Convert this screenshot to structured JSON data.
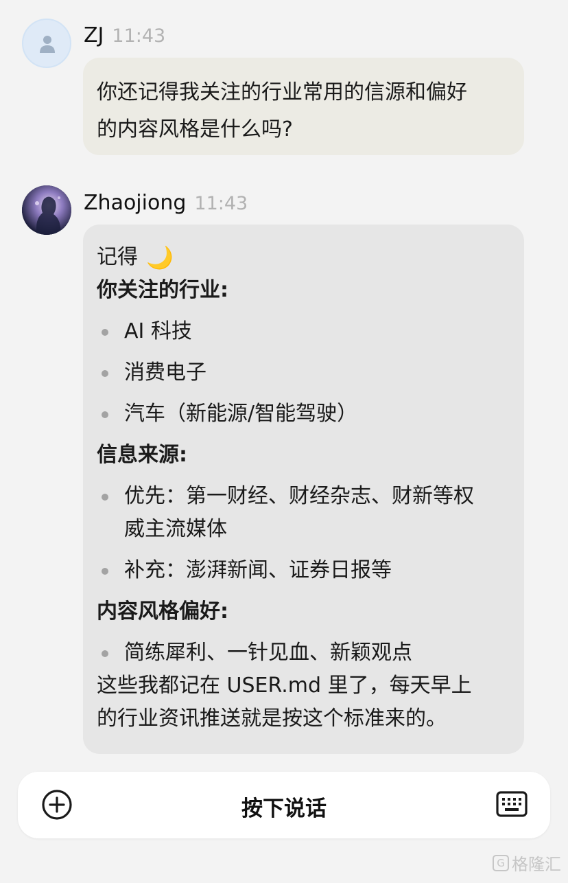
{
  "user_message": {
    "sender": "ZJ",
    "time": "11:43",
    "lines": [
      "你还记得我关注的行业常用的信源和偏好",
      "的内容风格是什么吗?"
    ]
  },
  "bot_message": {
    "sender": "Zhaojiong",
    "time": "11:43",
    "intro": "记得",
    "intro_emoji": "🌙",
    "sections": [
      {
        "heading": "你关注的行业:",
        "items": [
          [
            "AI 科技"
          ],
          [
            "消费电子"
          ],
          [
            "汽车（新能源/智能驾驶）"
          ]
        ]
      },
      {
        "heading": "信息来源:",
        "items": [
          [
            "优先：第一财经、财经杂志、财新等权",
            "威主流媒体"
          ],
          [
            "补充：澎湃新闻、证券日报等"
          ]
        ]
      },
      {
        "heading": "内容风格偏好:",
        "items": [
          [
            "简练犀利、一针见血、新颖观点"
          ]
        ]
      }
    ],
    "closing": [
      "这些我都记在 USER.md 里了，每天早上",
      "的行业资讯推送就是按这个标准来的。"
    ]
  },
  "input_bar": {
    "voice_label": "按下说话",
    "plus_icon": "plus-circle-icon",
    "keyboard_icon": "keyboard-icon"
  },
  "watermark": {
    "text": "格隆汇",
    "mark": "G"
  },
  "colors": {
    "background": "#f3f3f3",
    "user_bubble": "#ecebe4",
    "bot_bubble": "#e6e6e6",
    "timestamp": "#b2b2b2",
    "moon": "#f3b530"
  }
}
